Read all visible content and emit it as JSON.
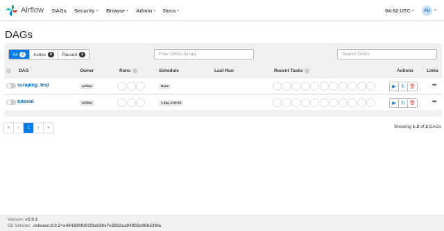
{
  "nav": {
    "brand": "Airflow",
    "items": [
      {
        "label": "DAGs",
        "dropdown": false
      },
      {
        "label": "Security",
        "dropdown": true
      },
      {
        "label": "Browse",
        "dropdown": true
      },
      {
        "label": "Admin",
        "dropdown": true
      },
      {
        "label": "Docs",
        "dropdown": true
      }
    ],
    "time": "04:52 UTC",
    "avatar": "AU"
  },
  "page_title": "DAGs",
  "filters": {
    "all": {
      "label": "All",
      "count": "2"
    },
    "active": {
      "label": "Active",
      "count": "0"
    },
    "paused": {
      "label": "Paused",
      "count": "2"
    }
  },
  "tag_filter": {
    "placeholder": "Filter DAGs by tag",
    "value": ""
  },
  "search": {
    "placeholder": "Search DAGs",
    "value": ""
  },
  "table": {
    "headers": {
      "dag": "DAG",
      "owner": "Owner",
      "runs": "Runs",
      "schedule": "Schedule",
      "last_run": "Last Run",
      "recent_tasks": "Recent Tasks",
      "actions": "Actions",
      "links": "Links"
    },
    "rows": [
      {
        "dag_id": "scraping_test",
        "owner": "airflow",
        "schedule": "None",
        "last_run": "",
        "links": "•••"
      },
      {
        "dag_id": "tutorial",
        "owner": "airflow",
        "schedule": "1 day, 0:00:00",
        "last_run": "",
        "links": "•••"
      }
    ]
  },
  "pagination": {
    "first": "«",
    "prev": "‹",
    "current": "1",
    "next": "›",
    "last": "»"
  },
  "showing": {
    "prefix": "Showing ",
    "range": "1-2",
    "middle": " of ",
    "total": "2",
    "suffix": " DAGs"
  },
  "footer": {
    "version_label": "Version: ",
    "version": "v2.0.2",
    "git_label": "Git Version: ",
    "git": ".release:2.0.2+e494306fb01f3a026e7e2832ca94902e96b526fa"
  },
  "colors": {
    "accent": "#017cee",
    "link": "#0060b6",
    "delete": "#d9534f"
  }
}
